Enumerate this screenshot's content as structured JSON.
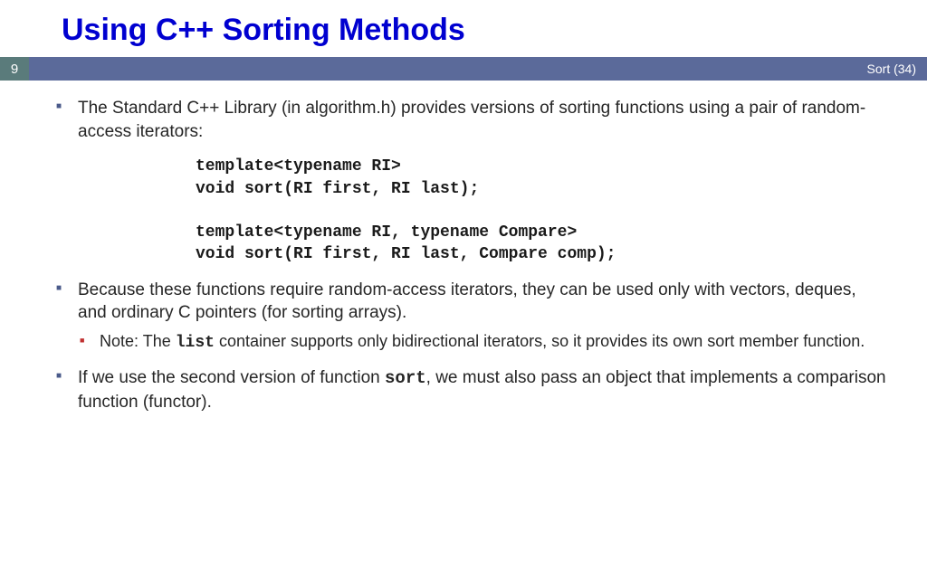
{
  "title": "Using C++ Sorting Methods",
  "slide_number": "9",
  "footer_right": "Sort (34)",
  "bullets": {
    "b1": "The Standard C++ Library (in algorithm.h) provides versions of sorting functions using a pair of random-access iterators:",
    "code": "template<typename RI>\nvoid sort(RI first, RI last);\n\ntemplate<typename RI, typename Compare>\nvoid sort(RI first, RI last, Compare comp);",
    "b2": "Because these functions require random-access iterators, they can be used only with vectors, deques, and ordinary C pointers (for sorting arrays).",
    "b2_sub_pre": "Note: The ",
    "b2_sub_code": "list",
    "b2_sub_post": " container supports only bidirectional iterators, so it provides its own sort member function.",
    "b3_pre": "If we use the second version of function ",
    "b3_code": "sort",
    "b3_post": ", we must also pass an object that implements a comparison function (functor)."
  }
}
